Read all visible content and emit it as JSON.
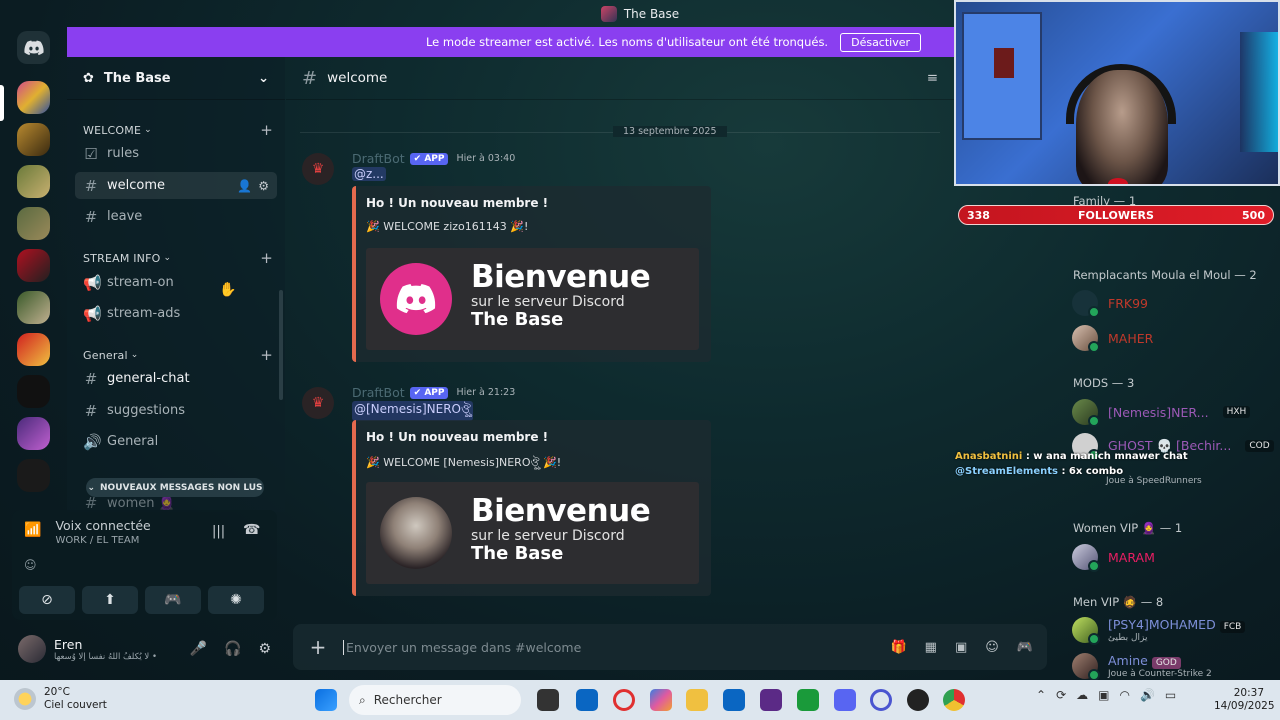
{
  "window": {
    "title": "The Base"
  },
  "banner": {
    "text": "Le mode streamer est activé. Les noms d'utilisateur ont été tronqués.",
    "button": "Désactiver"
  },
  "server": {
    "name": "The Base"
  },
  "sidebar": {
    "categories": [
      {
        "label": "WELCOME"
      },
      {
        "label": "STREAM INFO"
      },
      {
        "label": "General"
      }
    ],
    "channels": [
      {
        "label": "rules",
        "icon": "rules-icon"
      },
      {
        "label": "welcome",
        "icon": "hash-icon"
      },
      {
        "label": "leave",
        "icon": "hash-icon"
      },
      {
        "label": "stream-on",
        "icon": "megaphone-icon"
      },
      {
        "label": "stream-ads",
        "icon": "megaphone-icon"
      },
      {
        "label": "general-chat",
        "icon": "hash-icon"
      },
      {
        "label": "suggestions",
        "icon": "hash-icon"
      },
      {
        "label": "General",
        "icon": "speaker-icon"
      }
    ],
    "new_messages": "NOUVEAUX MESSAGES NON LUS",
    "partial_channel": "women 🧕"
  },
  "voice": {
    "status": "Voix connectée",
    "channel": "WORK / EL TEAM"
  },
  "user": {
    "name": "Eren",
    "status": "لا يُكلِّفُ اللهُ نفساً إلا وُسعها •"
  },
  "channel_header": {
    "name": "welcome"
  },
  "divider": {
    "date": "13 septembre 2025"
  },
  "messages": [
    {
      "author": "DraftBot",
      "tag": "✔ APP",
      "time": "Hier à 03:40",
      "mention": "@z...",
      "embed_title": "Ho ! Un nouveau membre !",
      "embed_desc": "🎉 WELCOME zizo161143 🎉!",
      "image": {
        "line1": "Bienvenue",
        "line2": "sur le serveur Discord",
        "line3": "The Base"
      }
    },
    {
      "author": "DraftBot",
      "tag": "✔ APP",
      "time": "Hier à 21:23",
      "mention": "@[Nemesis]NERO⁠ঔৣ⁠",
      "embed_title": "Ho ! Un nouveau membre !",
      "embed_desc": "🎉 WELCOME [Nemesis]NERO⁠ঔৣ⁠ 🎉!",
      "image": {
        "line1": "Bienvenue",
        "line2": "sur le serveur Discord",
        "line3": "The Base"
      }
    }
  ],
  "composer": {
    "placeholder": "Envoyer un message dans #welcome"
  },
  "followers": {
    "current": "338",
    "label": "FOLLOWERS",
    "goal": "500"
  },
  "members": {
    "groups": [
      {
        "label": "Family — 1"
      },
      {
        "label": "Remplacants Moula el Moul — 2"
      },
      {
        "label": "MODS — 3"
      },
      {
        "label": "Women VIP 🧕 — 1"
      },
      {
        "label": "Men VIP 🧔 — 8"
      }
    ],
    "items": [
      {
        "name": "FRK99",
        "color": "#c0392b"
      },
      {
        "name": "MAHER",
        "color": "#c0392b"
      },
      {
        "name": "[Nemesis]NER...",
        "color": "#9b59b6",
        "badge": "HXH"
      },
      {
        "name": "GHOST 💀 [Bechir...",
        "color": "#9b59b6",
        "badge": "COD"
      },
      {
        "name": "",
        "sub": "Joue à SpeedRunners"
      },
      {
        "name": "MARAM",
        "color": "#e91e63"
      },
      {
        "name": "[PSY4]MOHAMED",
        "color": "#7d8fd8",
        "badge": "FCB",
        "sub": "يزال بطيئ"
      },
      {
        "name": "Amine",
        "color": "#7d8fd8",
        "badge": "GOD",
        "sub": "Joue à Counter-Strike 2"
      }
    ]
  },
  "stream_overlay": {
    "line1_user": "Anasbatnini",
    "line1_text": ": w ana manich mnawer chat",
    "line2_user": "@StreamElements",
    "line2_text": ": 6x",
    "line2_extra": "combo"
  },
  "taskbar": {
    "weather_temp": "20°C",
    "weather_desc": "Ciel couvert",
    "search": "Rechercher",
    "time": "20:37",
    "date": "14/09/2025"
  },
  "colors": {
    "banner": "#8a3ff0",
    "accent": "#5865f2",
    "embed_border": "#e46a4e",
    "followers": "#d01820"
  }
}
